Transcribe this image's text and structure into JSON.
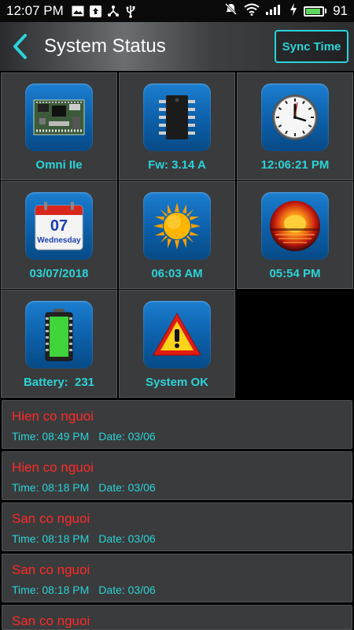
{
  "status_bar": {
    "time": "12:07 PM",
    "battery_level": "91",
    "battery_fraction": 0.91
  },
  "app_bar": {
    "title": "System Status",
    "back_icon": "chevron-left-icon",
    "sync_label": "Sync Time"
  },
  "tiles": [
    {
      "label": "Omni IIe",
      "icon": "circuit-board-icon"
    },
    {
      "label": "Fw: 3.14 A",
      "icon": "chip-icon"
    },
    {
      "label": "12:06:21 PM",
      "icon": "clock-icon"
    },
    {
      "label": "03/07/2018",
      "icon": "calendar-icon",
      "calendar_day": "07",
      "calendar_weekday": "Wednesday"
    },
    {
      "label": "06:03 AM",
      "icon": "sunrise-icon"
    },
    {
      "label": "05:54 PM",
      "icon": "sunset-icon"
    },
    {
      "label": "Battery:  231",
      "icon": "battery-icon"
    },
    {
      "label": "System OK",
      "icon": "warning-icon"
    }
  ],
  "events": [
    {
      "name": "Hien co nguoi",
      "time": "Time: 08:49 PM",
      "date": "Date: 03/06"
    },
    {
      "name": "Hien co nguoi",
      "time": "Time: 08:18 PM",
      "date": "Date: 03/06"
    },
    {
      "name": "San co nguoi",
      "time": "Time: 08:18 PM",
      "date": "Date: 03/06"
    },
    {
      "name": "San co nguoi",
      "time": "Time: 08:18 PM",
      "date": "Date: 03/06"
    },
    {
      "name": "San co nguoi",
      "time": "",
      "date": ""
    }
  ],
  "colors": {
    "accent": "#2bd3d8",
    "event_name": "#ff2a2a",
    "tile_bg": "#3a3b3c"
  }
}
